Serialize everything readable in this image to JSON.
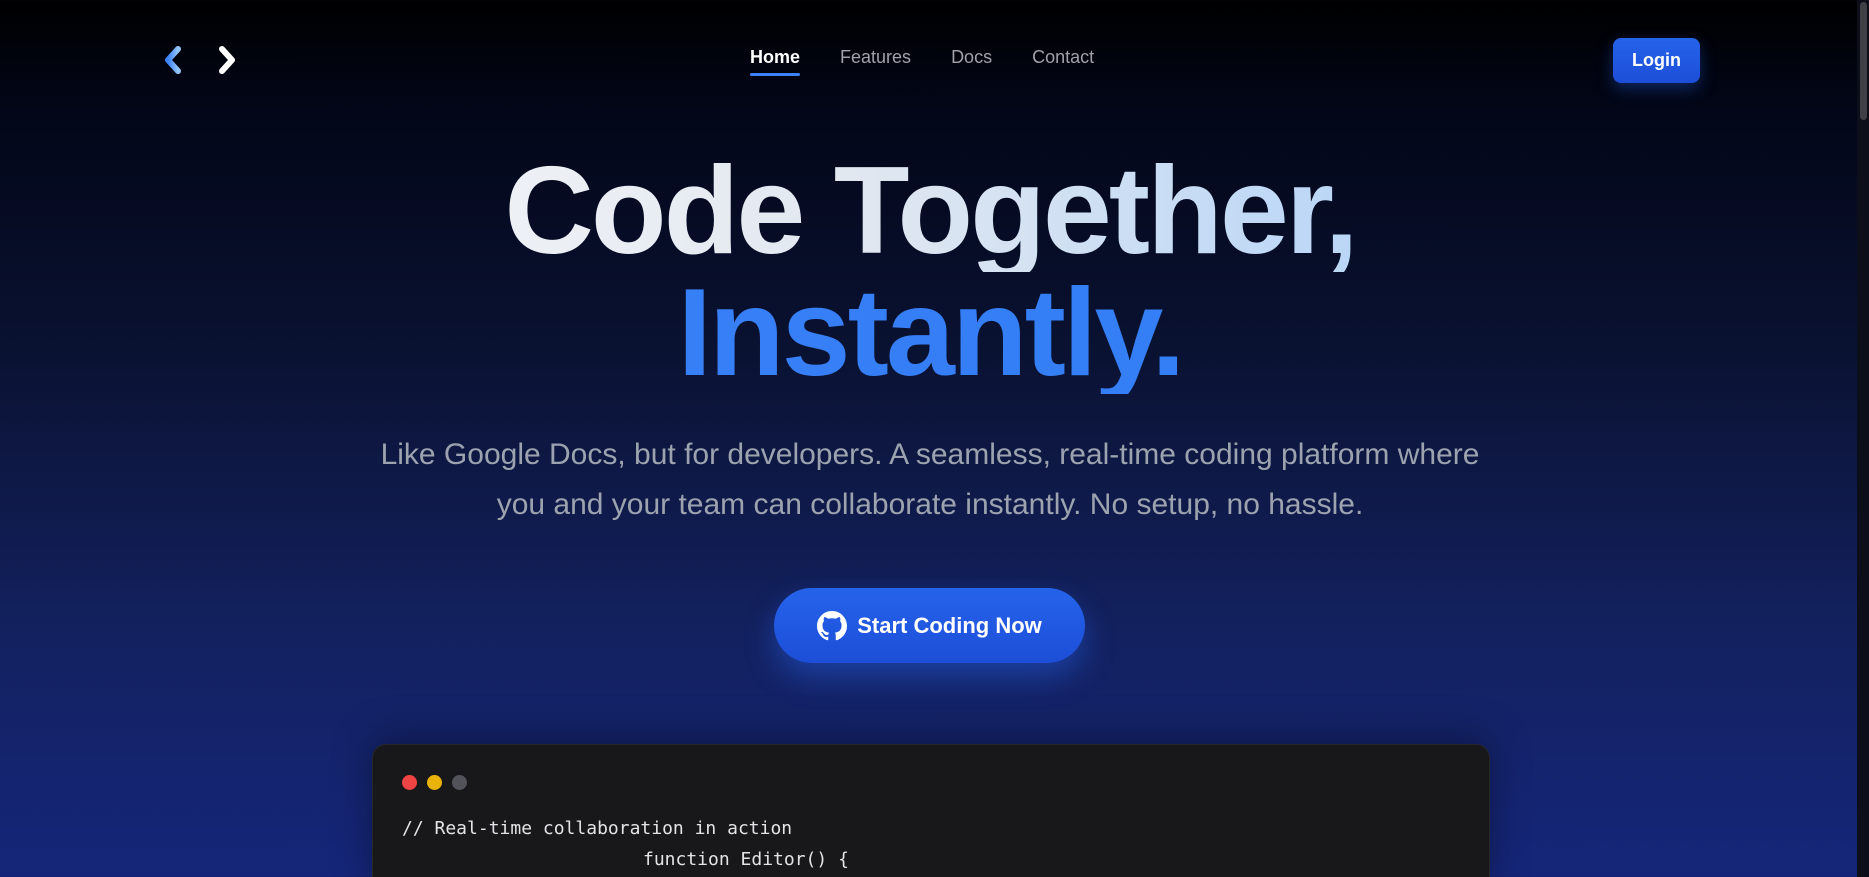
{
  "nav": {
    "logo_icon": "code-arrows-icon",
    "links": [
      {
        "label": "Home",
        "active": true
      },
      {
        "label": "Features",
        "active": false
      },
      {
        "label": "Docs",
        "active": false
      },
      {
        "label": "Contact",
        "active": false
      }
    ],
    "login_label": "Login"
  },
  "hero": {
    "title_line1": "Code Together,",
    "title_line2": "Instantly.",
    "subtitle": "Like Google Docs, but for developers. A seamless, real-time coding platform where you and your team can collaborate instantly. No setup, no hassle.",
    "cta_label": "Start Coding Now",
    "cta_icon": "github-icon"
  },
  "code_window": {
    "dot_colors": [
      "#ef4444",
      "#eab308",
      "#52525b"
    ],
    "comment": "// Real-time collaboration in action",
    "line2": "function Editor() {"
  },
  "colors": {
    "accent": "#2563eb",
    "title_blue": "#3b82f6",
    "muted_text": "#9ca3af"
  }
}
